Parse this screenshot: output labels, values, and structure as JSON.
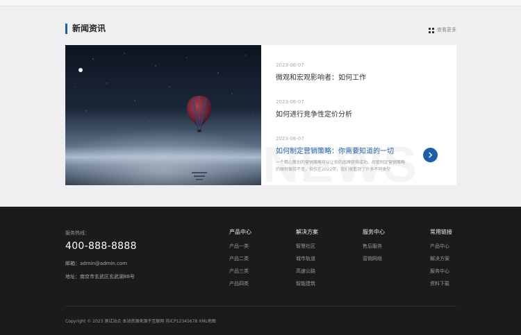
{
  "news": {
    "title": "新闻资讯",
    "more_label": "查看更多",
    "items": [
      {
        "date": "2023-06-07",
        "title": "微观和宏观影响者：如何工作"
      },
      {
        "date": "2023-06-07",
        "title": "如何进行竞争性定价分析"
      },
      {
        "date": "2023-06-07",
        "title": "如何制定营销策略：你需要知道的一切",
        "desc": "一个精心策划的营销策略可以让你的品牌获得成功。尽管制定营销策略的原则保持不变，但仅在2022年，我们就看到了许多不同类型"
      }
    ],
    "watermark": "NEWS",
    "colors": {
      "accent": "#1f5fa8"
    }
  },
  "footer": {
    "hotline_label": "服务热线：",
    "phone": "400-888-8888",
    "email": "邮箱：admin@admin.com",
    "address": "地址：南京市玄武区玄武湖88号",
    "columns": [
      {
        "heading": "产品中心",
        "links": [
          "产品一类",
          "产品二类",
          "产品三类",
          "产品四类"
        ]
      },
      {
        "heading": "解决方案",
        "links": [
          "智慧社区",
          "城市轨道",
          "高速公路",
          "智能建筑"
        ]
      },
      {
        "heading": "服务中心",
        "links": [
          "售后服务",
          "营销网络"
        ]
      },
      {
        "heading": "常用链接",
        "links": [
          "产品中心",
          "解决方案",
          "服务中心",
          "资料下载"
        ]
      }
    ],
    "copyright": "Copyright © 2023 测试站点 本站资源来源于互联网   苏ICP12345678   XML地图"
  }
}
